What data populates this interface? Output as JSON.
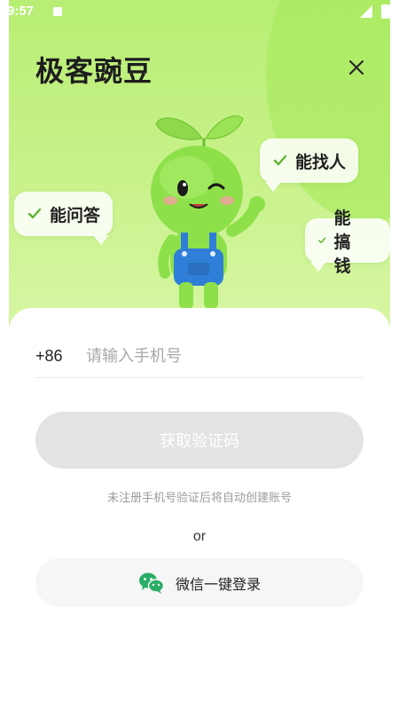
{
  "status_bar": {
    "time": "9:57"
  },
  "app": {
    "title": "极客豌豆"
  },
  "bubbles": {
    "ask": "能问答",
    "find": "能找人",
    "money": "能搞钱"
  },
  "login": {
    "country_code": "+86",
    "phone_placeholder": "请输入手机号",
    "get_code_label": "获取验证码",
    "hint": "未注册手机号验证后将自动创建账号",
    "or_label": "or",
    "wechat_label": "微信一键登录"
  },
  "colors": {
    "hero_green": "#b7ee73",
    "check_green": "#5cb531",
    "wechat_green": "#2aae67",
    "button_disabled": "#e3e3e3"
  },
  "icons": [
    "close-icon",
    "check-icon",
    "wechat-icon",
    "mascot-illustration"
  ]
}
